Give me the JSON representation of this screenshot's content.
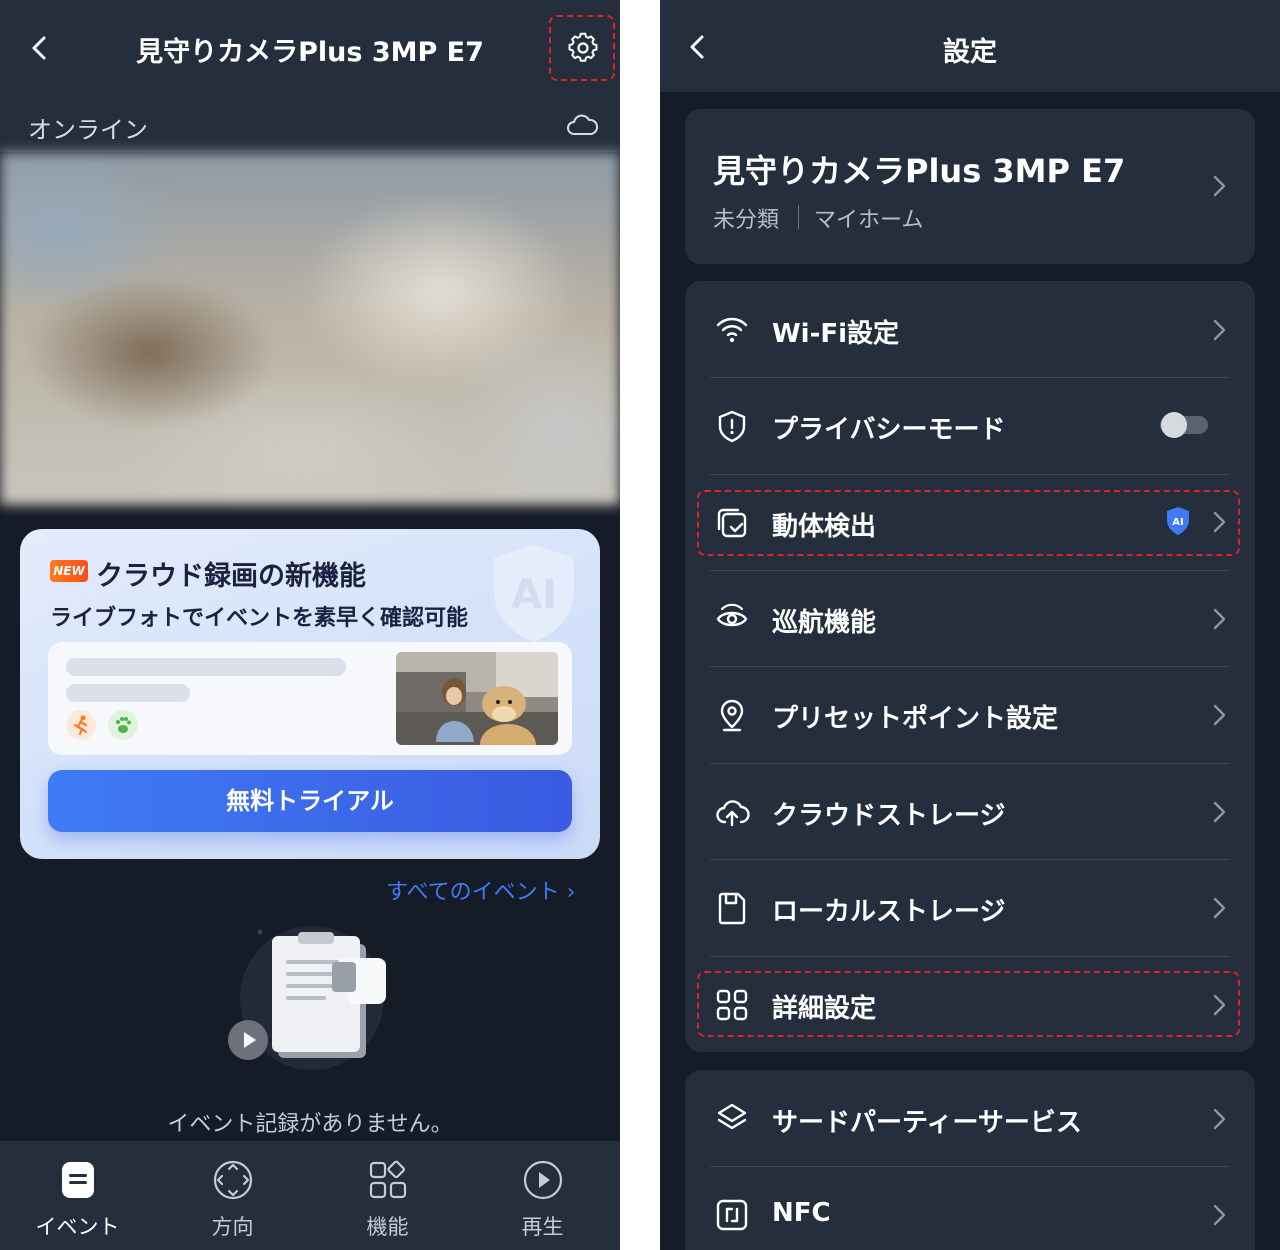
{
  "left": {
    "header": {
      "title": "見守りカメラPlus 3MP E7"
    },
    "status": {
      "text": "オンライン"
    },
    "promo": {
      "badge": "NEW",
      "title": "クラウド録画の新機能",
      "subtitle": "ライブフォトでイベントを素早く確認可能",
      "shield_text": "AI",
      "button_label": "無料トライアル"
    },
    "events": {
      "all_events_link": "すべてのイベント ›",
      "empty_text": "イベント記録がありません。"
    },
    "tabs": [
      {
        "label": "イベント",
        "icon": "event-icon",
        "active": true
      },
      {
        "label": "方向",
        "icon": "direction-icon",
        "active": false
      },
      {
        "label": "機能",
        "icon": "functions-icon",
        "active": false
      },
      {
        "label": "再生",
        "icon": "play-icon",
        "active": false
      }
    ]
  },
  "right": {
    "header": {
      "title": "設定"
    },
    "device": {
      "name": "見守りカメラPlus 3MP E7",
      "category": "未分類",
      "home": "マイホーム"
    },
    "settings": [
      {
        "label": "Wi-Fi設定",
        "icon": "wifi-icon"
      },
      {
        "label": "プライバシーモード",
        "icon": "shield-icon",
        "toggle": false
      },
      {
        "label": "動体検出",
        "icon": "motion-detection-icon",
        "badge": "AI"
      },
      {
        "label": "巡航機能",
        "icon": "patrol-eye-icon"
      },
      {
        "label": "プリセットポイント設定",
        "icon": "location-pin-icon"
      },
      {
        "label": "クラウドストレージ",
        "icon": "cloud-upload-icon"
      },
      {
        "label": "ローカルストレージ",
        "icon": "sd-card-icon"
      },
      {
        "label": "詳細設定",
        "icon": "grid-icon"
      }
    ],
    "more_settings": [
      {
        "label": "サードパーティーサービス",
        "icon": "layers-icon"
      },
      {
        "label": "NFC",
        "icon": "nfc-icon"
      }
    ]
  },
  "colors": {
    "background": "#151b27",
    "panel": "#252e3d",
    "accent_blue": "#3f7bf6",
    "highlight_red": "#e0202a"
  }
}
